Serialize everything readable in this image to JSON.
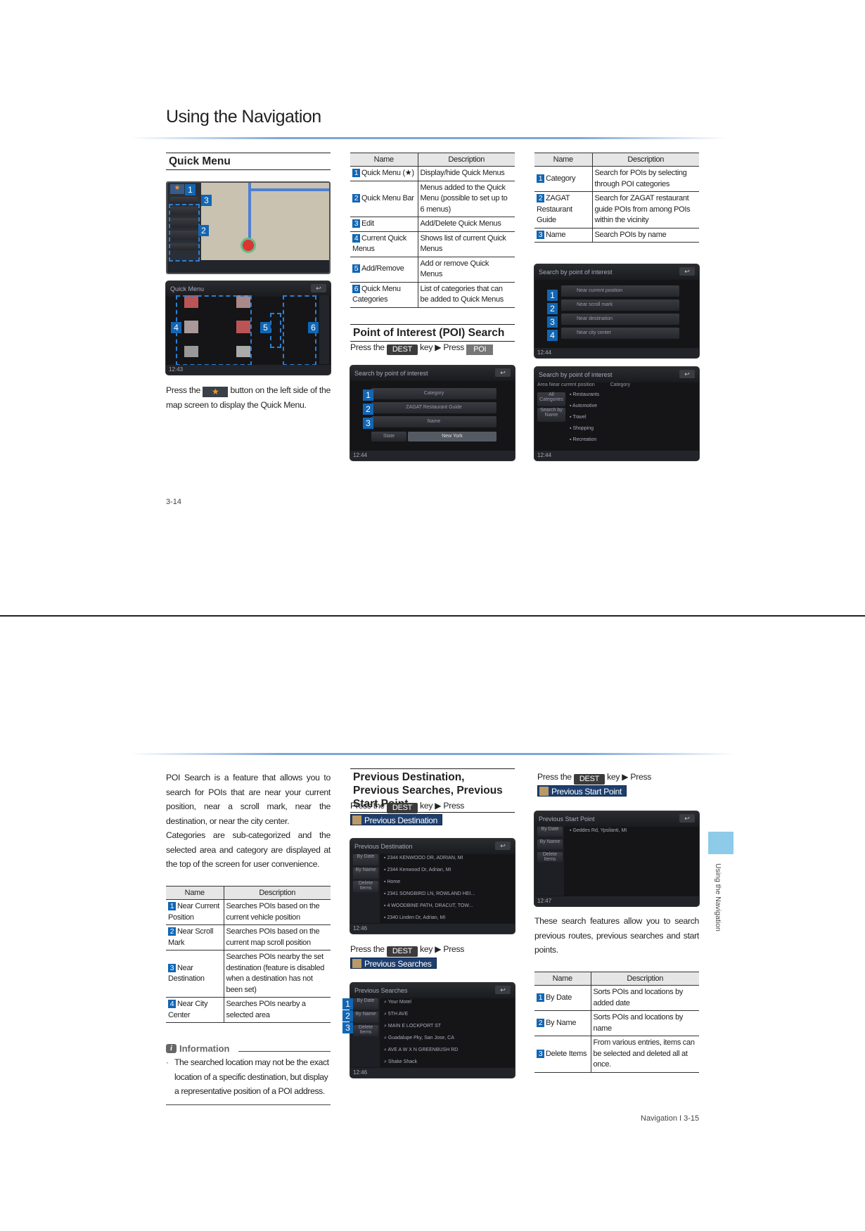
{
  "page_top": {
    "title": "Using the Navigation",
    "page_number": "3-14",
    "quick_menu": {
      "heading": "Quick Menu",
      "instruction_before": "Press the",
      "instruction_after": "button on the left side of the map screen to display the Quick Menu.",
      "star_button_icon": "★",
      "screen2_title": "Quick Menu",
      "screen2_clock": "12:43",
      "markers": [
        "1",
        "2",
        "3",
        "4",
        "5",
        "6"
      ]
    },
    "quick_menu_table": {
      "headers": [
        "Name",
        "Description"
      ],
      "rows": [
        {
          "num": "1",
          "name": "Quick Menu (★)",
          "desc": "Display/hide Quick Menus"
        },
        {
          "num": "2",
          "name": "Quick Menu Bar",
          "desc": "Menus added to the Quick Menu (possible to set up to 6 menus)"
        },
        {
          "num": "3",
          "name": "Edit",
          "desc": "Add/Delete Quick Menus"
        },
        {
          "num": "4",
          "name": "Current Quick Menus",
          "desc": "Shows list of current Quick Menus"
        },
        {
          "num": "5",
          "name": "Add/Remove",
          "desc": "Add or remove Quick Menus"
        },
        {
          "num": "6",
          "name": "Quick Menu Categories",
          "desc": "List of categories that can be added to Quick Menus"
        }
      ]
    },
    "poi_search": {
      "heading": "Point of Interest (POI) Search",
      "press_the": "Press the",
      "dest_key": "DEST",
      "key_press": "key ▶ Press",
      "poi_key": "POI",
      "screen_title": "Search by point of interest",
      "screen_buttons": [
        "Category",
        "ZAGAT Restaurant Guide",
        "Name"
      ],
      "state_label": "State",
      "state_value": "New York",
      "clock": "12:44"
    },
    "poi_table": {
      "headers": [
        "Name",
        "Description"
      ],
      "rows": [
        {
          "num": "1",
          "name": "Category",
          "desc": "Search for POIs by selecting through POI categories"
        },
        {
          "num": "2",
          "name": "ZAGAT Restaurant Guide",
          "desc": "Search for ZAGAT restaurant guide POIs from among POIs within the vicinity"
        },
        {
          "num": "3",
          "name": "Name",
          "desc": "Search POIs by name"
        }
      ]
    },
    "category_screen": {
      "title": "Search by point of interest",
      "options": [
        "Near current position",
        "Near scroll mark",
        "Near destination",
        "Near city center"
      ],
      "clock": "12:44"
    },
    "category_list_screen": {
      "title": "Search by point of interest",
      "area_label": "Area",
      "area_value": "Near current position",
      "category_label": "Category",
      "side_buttons": [
        "All Categories",
        "Search by Name"
      ],
      "items": [
        "Restaurants",
        "Automotive",
        "Travel",
        "Shopping",
        "Recreation"
      ],
      "clock": "12:44"
    }
  },
  "page_bottom": {
    "intro_paragraphs": [
      "POI Search is a feature that allows you to search for POIs that are near your current position, near a scroll mark, near the destination, or near the city center.",
      "Categories are sub-categorized and the selected area and category are displayed at the top of the screen for user convenience."
    ],
    "near_table": {
      "headers": [
        "Name",
        "Description"
      ],
      "rows": [
        {
          "num": "1",
          "name": "Near Current Position",
          "desc": "Searches POIs based on the current vehicle position"
        },
        {
          "num": "2",
          "name": "Near Scroll Mark",
          "desc": "Searches POIs based on the current map scroll position"
        },
        {
          "num": "3",
          "name": "Near Destination",
          "desc": "Searches POIs nearby the set destination (feature is disabled when a destination has not been set)"
        },
        {
          "num": "4",
          "name": "Near City Center",
          "desc": "Searches POIs nearby a selected area"
        }
      ]
    },
    "information": {
      "title": "Information",
      "bullet": "The searched location may not be the exact location of a specific destination, but display a representative position of a POI address."
    },
    "previous": {
      "heading": "Previous Destination, Previous Searches, Previous Start Point",
      "press_the": "Press the",
      "dest_key": "DEST",
      "key_press": "key ▶ Press",
      "prev_dest_button": "Previous Destination",
      "prev_searches_button": "Previous Searches",
      "prev_start_button": "Previous Start Point",
      "prev_dest_screen": {
        "title": "Previous Destination",
        "side_buttons": [
          "By Date",
          "By Name",
          "Delete Items"
        ],
        "items": [
          "2344 KENWOOD DR, ADRIAN, MI",
          "2344 Kenwood Dr, Adrian, MI",
          "Home",
          "2341 SONGBIRD LN, ROWLAND HEI...",
          "4 WOODBINE PATH, DRACUT, TOW...",
          "2340 Linden Dr, Adrian, MI"
        ],
        "clock": "12:46"
      },
      "prev_searches_screen": {
        "title": "Previous Searches",
        "side_buttons": [
          "By Date",
          "By Name",
          "Delete Items"
        ],
        "items": [
          "Your Motel",
          "5TH AVE",
          "MAIN E LOCKPORT ST",
          "Guadalupe Pky, San Jose, CA",
          "AVE A W X N GREENBUSH RD",
          "Shake Shack"
        ],
        "clock": "12:46"
      },
      "prev_start_screen": {
        "title": "Previous Start Point",
        "side_buttons": [
          "By Date",
          "By Name",
          "Delete Items"
        ],
        "items": [
          "Geddes Rd, Ypsilanti, MI"
        ],
        "clock": "12:47"
      },
      "summary": "These search features allow you to search previous routes, previous searches and start points."
    },
    "sort_table": {
      "headers": [
        "Name",
        "Description"
      ],
      "rows": [
        {
          "num": "1",
          "name": "By Date",
          "desc": "Sorts POIs and locations by added date"
        },
        {
          "num": "2",
          "name": "By Name",
          "desc": "Sorts POIs and locations by name"
        },
        {
          "num": "3",
          "name": "Delete Items",
          "desc": "From various entries, items can be selected and deleted all at once."
        }
      ]
    },
    "footer": "Navigation I 3-15",
    "side_tab_label": "Using the Navigation"
  },
  "colors": {
    "marker_blue": "#1266b3",
    "gradient_blue": "#7fa6d6",
    "side_tab": "#8dcbe9",
    "dest_key": "#3b3b3b",
    "menu_button_blue": "#1d3f6e"
  }
}
